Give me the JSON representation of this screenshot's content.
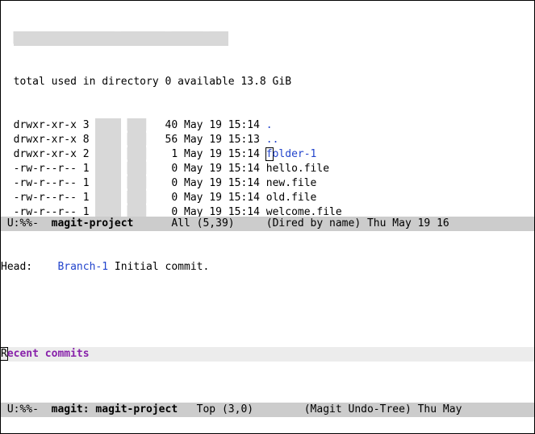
{
  "dired": {
    "summary_prefix": "  total used in directory ",
    "summary_used": "0",
    "summary_mid": " available ",
    "summary_avail": "13.8 GiB",
    "entries": [
      {
        "perm": "drwxr-xr-x",
        "links": "3",
        "owner": "████",
        "group": "███",
        "size": "40",
        "date": "May 19 15:14",
        "name": ".",
        "name_class": "blue",
        "cursor": false
      },
      {
        "perm": "drwxr-xr-x",
        "links": "8",
        "owner": "████",
        "group": "███",
        "size": "56",
        "date": "May 19 15:13",
        "name": "..",
        "name_class": "blue",
        "cursor": false
      },
      {
        "perm": "drwxr-xr-x",
        "links": "2",
        "owner": "████",
        "group": "███",
        "size": "1",
        "date": "May 19 15:14",
        "name": "folder-1",
        "name_class": "blue",
        "cursor": true
      },
      {
        "perm": "-rw-r--r--",
        "links": "1",
        "owner": "████",
        "group": "███",
        "size": "0",
        "date": "May 19 15:14",
        "name": "hello.file",
        "name_class": "",
        "cursor": false
      },
      {
        "perm": "-rw-r--r--",
        "links": "1",
        "owner": "████",
        "group": "███",
        "size": "0",
        "date": "May 19 15:14",
        "name": "new.file",
        "name_class": "",
        "cursor": false
      },
      {
        "perm": "-rw-r--r--",
        "links": "1",
        "owner": "████",
        "group": "███",
        "size": "0",
        "date": "May 19 15:14",
        "name": "old.file",
        "name_class": "",
        "cursor": false
      },
      {
        "perm": "-rw-r--r--",
        "links": "1",
        "owner": "████",
        "group": "███",
        "size": "0",
        "date": "May 19 15:14",
        "name": "welcome.file",
        "name_class": "",
        "cursor": false
      }
    ],
    "modeline": {
      "status": " U:%%-  ",
      "buffer": "magit-project",
      "pos": "      All (5,39)     ",
      "mode": "(Dired by name)",
      "time": " Thu May 19 16"
    }
  },
  "magit": {
    "head_label": "Head:    ",
    "head_branch": "Branch-1",
    "head_msg": " Initial commit.",
    "section": "Recent commits",
    "modeline": {
      "status": " U:%%-  ",
      "buffer": "magit: magit-project",
      "pos": "   Top (3,0)        ",
      "mode": "(Magit Undo-Tree)",
      "time": " Thu May "
    }
  }
}
